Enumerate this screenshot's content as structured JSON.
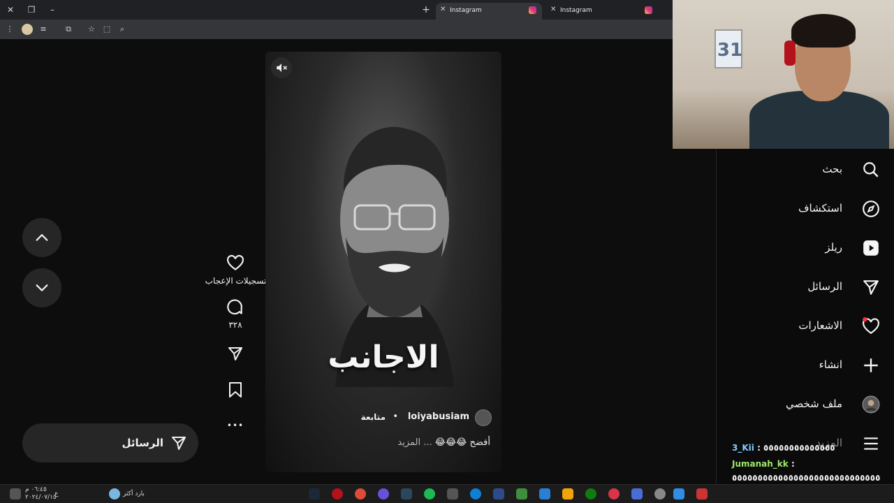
{
  "browser": {
    "tabs": [
      {
        "title": "Instagram",
        "active": true
      },
      {
        "title": "Instagram",
        "active": false
      }
    ],
    "window_controls": [
      "close-icon",
      "restore-icon",
      "minimize-icon"
    ],
    "toolbar_icons": [
      "menu-dots-icon",
      "profile-avatar-icon",
      "media-control-icon",
      "extensions-icon",
      "bookmark-star-icon",
      "screenshot-icon",
      "zoom-icon"
    ]
  },
  "reel": {
    "overlay_text": "الاجانب",
    "username": "loiyabusiam",
    "dot": "•",
    "follow_label": "متابعة",
    "caption": "أفضح 😂😂😂",
    "more_label": "... المزيد"
  },
  "actions": {
    "likes_label": "تسجيلات الإعجاب",
    "comments_count": "٣٢٨",
    "more_icon": "•••"
  },
  "messages_button": {
    "label": "الرسائل"
  },
  "sidebar": {
    "items": [
      {
        "label": "بحث",
        "icon": "search-icon"
      },
      {
        "label": "استكشاف",
        "icon": "explore-icon"
      },
      {
        "label": "ريلز",
        "icon": "reels-icon"
      },
      {
        "label": "الرسائل",
        "icon": "messages-icon"
      },
      {
        "label": "الاشعارات",
        "icon": "notifications-icon"
      },
      {
        "label": "انشاء",
        "icon": "create-icon"
      },
      {
        "label": "ملف شخصي",
        "icon": "profile-icon"
      },
      {
        "label": "المزيد",
        "icon": "menu-icon"
      }
    ]
  },
  "chat": {
    "lines": [
      {
        "user": "3_Kii",
        "text": ": ٥٥٥٥٥٥٥٥٥٥٥٥٥٥"
      },
      {
        "user": "Jumanah_kk",
        "text": ":"
      },
      {
        "user": "",
        "text": "٥٥٥٥٥٥٥٥٥٥٥٥٥٥٥٥٥٥٥٥٥٥٥٥٥٥٥٥٥"
      }
    ]
  },
  "webcam": {
    "jersey_number": "31"
  },
  "taskbar": {
    "weather": "بارد أكثر",
    "time": "٠٦:٤٥ م",
    "date": "٢٠٢٤/٠٧/١٥",
    "lang": "ع"
  },
  "colors": {
    "background": "#0d0d0d",
    "panel": "#262626",
    "text": "#f5f5f5",
    "notification_dot": "#ff3040"
  }
}
